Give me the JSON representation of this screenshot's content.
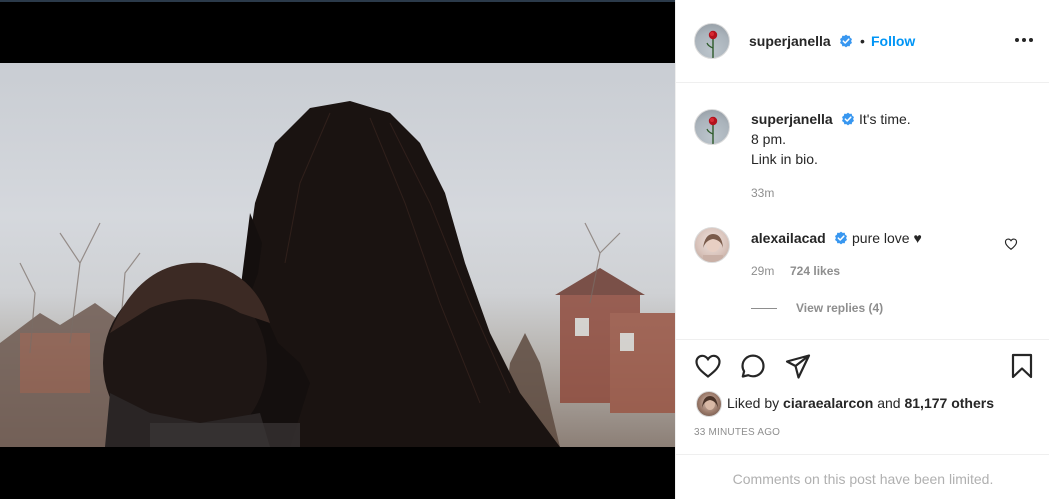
{
  "post": {
    "author": {
      "username": "superjanella",
      "verified": true,
      "follow_label": "Follow",
      "separator": "•"
    },
    "caption": {
      "line1": "It's time.",
      "line2": "8 pm.",
      "line3": "Link in bio.",
      "time": "33m"
    },
    "comments": [
      {
        "username": "alexailacad",
        "verified": true,
        "text": "pure love ♥",
        "time": "29m",
        "likes": "724 likes",
        "view_replies": "View replies (4)"
      }
    ],
    "liked_by": {
      "prefix": "Liked by",
      "user": "ciaraealarcon",
      "conjunction": "and",
      "count": "81,177 others"
    },
    "posted_ago": "33 MINUTES AGO",
    "comments_limited": "Comments on this post have been limited."
  },
  "icons": {
    "more": "more-options-icon",
    "like": "heart-icon",
    "comment": "comment-icon",
    "share": "share-icon",
    "save": "bookmark-icon",
    "verified": "verified-badge-icon"
  },
  "colors": {
    "link_blue": "#0095f6",
    "verified_blue": "#3897f0",
    "text": "#262626",
    "muted": "#8e8e8e",
    "border": "#efefef"
  }
}
